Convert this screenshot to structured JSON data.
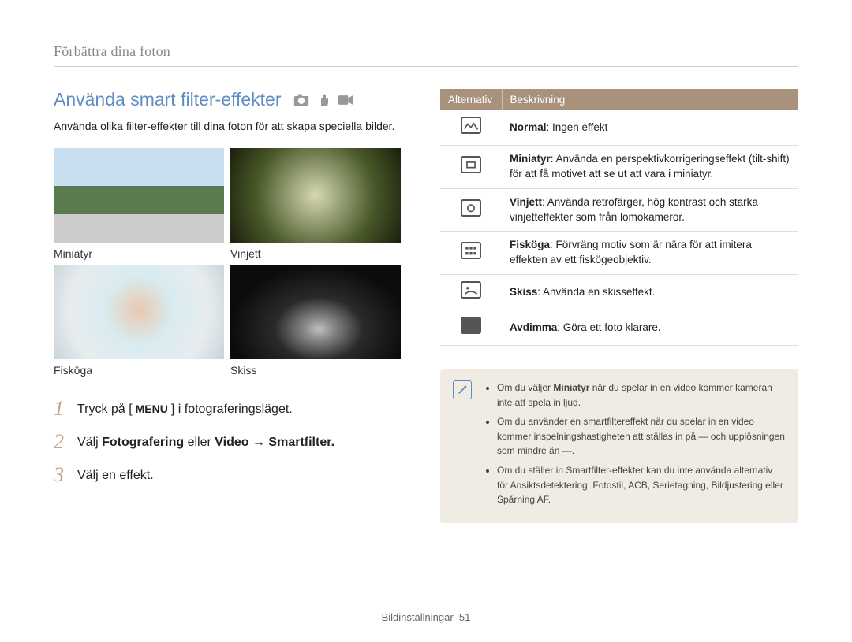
{
  "breadcrumb": "Förbättra dina foton",
  "heading": "Använda smart filter-effekter",
  "intro": "Använda olika filter-effekter till dina foton för att skapa speciella bilder.",
  "samples": {
    "miniatyr": "Miniatyr",
    "vinjett": "Vinjett",
    "fiskoga": "Fisköga",
    "skiss": "Skiss"
  },
  "steps": {
    "s1": {
      "num": "1",
      "pre": "Tryck på [",
      "menu": "MENU",
      "post": "] i fotograferingsläget."
    },
    "s2": {
      "num": "2",
      "pre": "Välj ",
      "b1": "Fotografering",
      "mid": " eller ",
      "b2": "Video",
      "arrow": " → ",
      "b3": "Smartfilter."
    },
    "s3": {
      "num": "3",
      "text": "Välj en effekt."
    }
  },
  "table": {
    "header_alt": "Alternativ",
    "header_desc": "Beskrivning",
    "rows": [
      {
        "term": "Normal",
        "desc": ": Ingen effekt"
      },
      {
        "term": "Miniatyr",
        "desc": ": Använda en perspektivkorrigeringseffekt (tilt-shift) för att få motivet att se ut att vara i miniatyr."
      },
      {
        "term": "Vinjett",
        "desc": ": Använda retrofärger, hög kontrast och starka vinjetteffekter som från lomokameror."
      },
      {
        "term": "Fisköga",
        "desc": ": Förvräng motiv som är nära för att imitera effekten av ett fiskögeobjektiv."
      },
      {
        "term": "Skiss",
        "desc": ": Använda en skisseffekt."
      },
      {
        "term": "Avdimma",
        "desc": ": Göra ett foto klarare."
      }
    ]
  },
  "notes": {
    "n1a": "Om du väljer ",
    "n1b": "Miniatyr",
    "n1c": " när du spelar in en video kommer kameran inte att spela in ljud.",
    "n2": "Om du använder en smartfiltereffekt när du spelar in en video kommer inspelningshastigheten att ställas in på ― och upplösningen som mindre än ―.",
    "n3": "Om du ställer in Smartfilter-effekter kan du inte använda alternativ för Ansiktsdetektering, Fotostil, ACB, Serietagning, Bildjustering eller Spårning AF."
  },
  "icon_labels": {
    "hand": "hand",
    "cam": "camera",
    "movie": "movie",
    "640": "640"
  },
  "footer": {
    "section": "Bildinställningar",
    "page": "51"
  }
}
